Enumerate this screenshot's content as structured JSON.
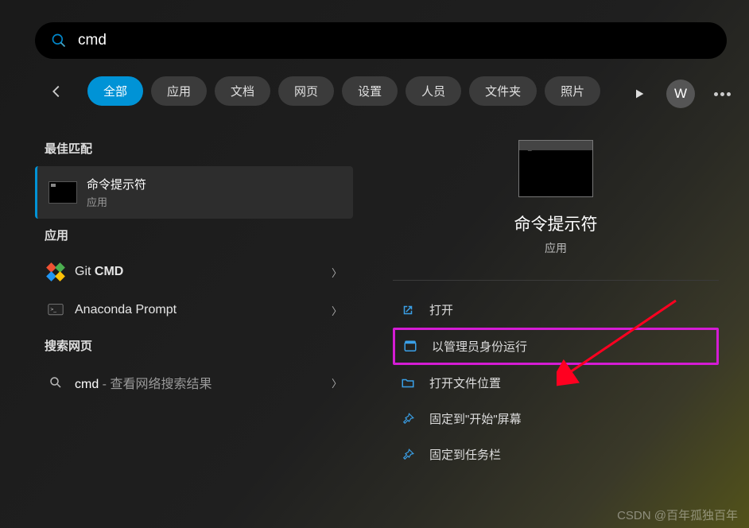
{
  "search": {
    "value": "cmd",
    "placeholder": ""
  },
  "tabs": {
    "items": [
      {
        "label": "全部",
        "active": true
      },
      {
        "label": "应用",
        "active": false
      },
      {
        "label": "文档",
        "active": false
      },
      {
        "label": "网页",
        "active": false
      },
      {
        "label": "设置",
        "active": false
      },
      {
        "label": "人员",
        "active": false
      },
      {
        "label": "文件夹",
        "active": false
      },
      {
        "label": "照片",
        "active": false
      }
    ]
  },
  "user": {
    "initial": "W"
  },
  "left": {
    "best_match_header": "最佳匹配",
    "best_match": {
      "title": "命令提示符",
      "subtitle": "应用"
    },
    "apps_header": "应用",
    "apps": [
      {
        "prefix": "Git ",
        "bold": "CMD"
      },
      {
        "prefix": "Anaconda Prompt",
        "bold": ""
      }
    ],
    "web_header": "搜索网页",
    "web": {
      "term": "cmd",
      "suffix": " - 查看网络搜索结果"
    }
  },
  "right": {
    "title": "命令提示符",
    "subtitle": "应用",
    "actions": [
      {
        "label": "打开",
        "highlighted": false
      },
      {
        "label": "以管理员身份运行",
        "highlighted": true
      },
      {
        "label": "打开文件位置",
        "highlighted": false
      },
      {
        "label": "固定到\"开始\"屏幕",
        "highlighted": false
      },
      {
        "label": "固定到任务栏",
        "highlighted": false
      }
    ]
  },
  "watermark": "CSDN @百年孤独百年",
  "colors": {
    "accent": "#0093d6",
    "highlight_border": "#d41cd4",
    "arrow": "#ff0020"
  }
}
